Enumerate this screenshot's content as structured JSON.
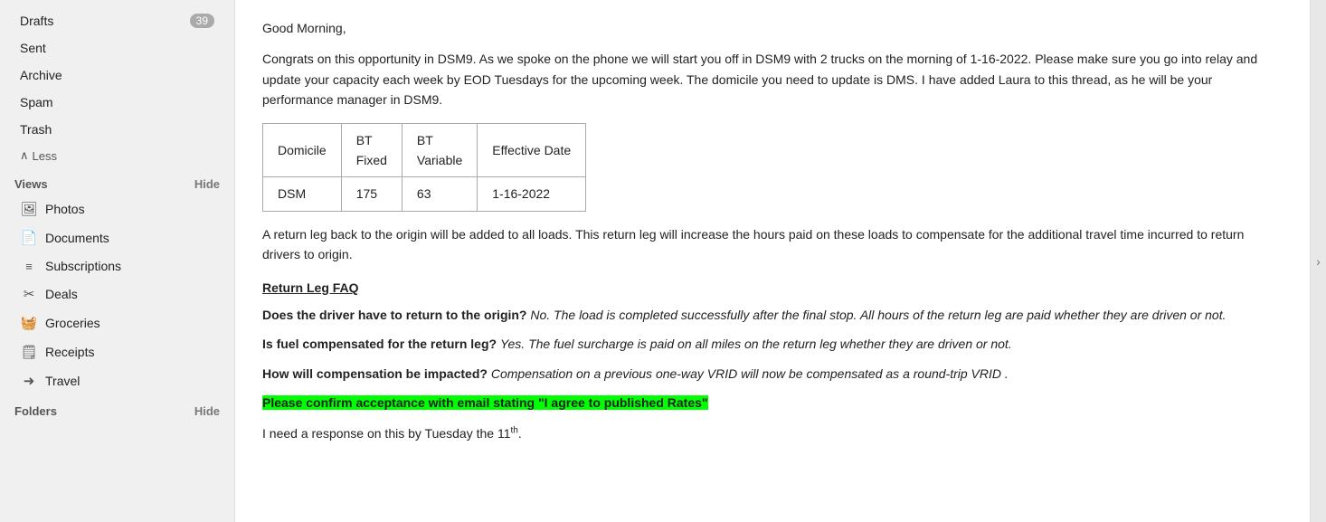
{
  "sidebar": {
    "items": [
      {
        "id": "drafts",
        "label": "Drafts",
        "badge": "39",
        "icon": ""
      },
      {
        "id": "sent",
        "label": "Sent",
        "badge": "",
        "icon": ""
      },
      {
        "id": "archive",
        "label": "Archive",
        "badge": "",
        "icon": ""
      },
      {
        "id": "spam",
        "label": "Spam",
        "badge": "",
        "icon": ""
      },
      {
        "id": "trash",
        "label": "Trash",
        "badge": "",
        "icon": ""
      }
    ],
    "less_label": "Less",
    "views_label": "Views",
    "views_hide": "Hide",
    "view_items": [
      {
        "id": "photos",
        "label": "Photos",
        "icon": "🖼"
      },
      {
        "id": "documents",
        "label": "Documents",
        "icon": "📄"
      },
      {
        "id": "subscriptions",
        "label": "Subscriptions",
        "icon": "≡"
      },
      {
        "id": "deals",
        "label": "Deals",
        "icon": "✂"
      },
      {
        "id": "groceries",
        "label": "Groceries",
        "icon": "🧺"
      },
      {
        "id": "receipts",
        "label": "Receipts",
        "icon": "🗒"
      },
      {
        "id": "travel",
        "label": "Travel",
        "icon": "→"
      }
    ],
    "folders_label": "Folders",
    "folders_hide": "Hide"
  },
  "email": {
    "greeting": "Good Morning,",
    "body1": "Congrats on this opportunity in DSM9. As we spoke on the phone we will start you off in DSM9 with 2 trucks on the morning of 1-16-2022. Please make sure you go into relay and update your capacity each week by EOD Tuesdays for the upcoming week. The domicile you need to update is DMS. I have added Laura to this thread, as he will be your performance manager in DSM9.",
    "table": {
      "headers": [
        "Domicile",
        "BT Fixed",
        "BT Variable",
        "Effective Date"
      ],
      "rows": [
        [
          "DSM",
          "175",
          "63",
          "1-16-2022"
        ]
      ]
    },
    "body2": "A return leg back to the origin will be added to all loads. This return leg will increase the hours paid on these loads to compensate for the additional travel time incurred to return drivers to origin.",
    "faq_title": "Return Leg FAQ",
    "faq": [
      {
        "question": "Does the driver have to return to the origin?",
        "answer": "No. The load is completed successfully after the final stop. All hours of the return leg are paid whether they are driven or not."
      },
      {
        "question": "Is fuel compensated for the return leg?",
        "answer": "Yes. The fuel surcharge is paid on all miles on the return leg whether they are driven or not."
      },
      {
        "question": "How will compensation be impacted?",
        "answer": "Compensation on a previous one-way VRID will now be compensated as a round-trip VRID ."
      }
    ],
    "highlight_text": "Please confirm acceptance with email stating \"I agree to published Rates\"",
    "closing": "I need a response on this by Tuesday the 11",
    "closing_superscript": "th",
    "closing_end": "."
  }
}
